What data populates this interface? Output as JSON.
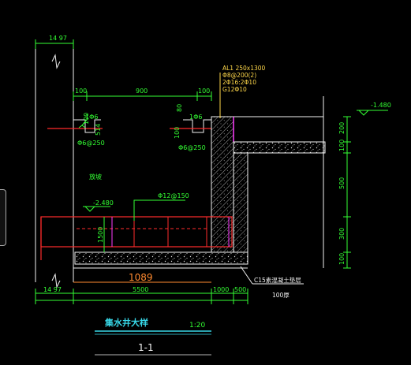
{
  "dims": {
    "top_left_width": "14 97",
    "top_span_left": "100",
    "top_span_mid": "900",
    "top_span_right": "100",
    "right_small_80": "80",
    "bottom_left_width": "14 97",
    "bottom_span_main": "5500",
    "bottom_span_1000": "1000",
    "bottom_span_500": "500",
    "right_200": "200",
    "right_500": "500",
    "right_300": "300",
    "right_100_top": "100",
    "right_100_bottom": "100",
    "height_1500": "1500",
    "level_top": "-1.480",
    "level_bottom": "-2.480",
    "small_left_100": "100",
    "small_left_514": "514",
    "small_right_100": "100",
    "orange_1089": "1089"
  },
  "labels": {
    "rebar_left_top": "1Φ6",
    "rebar_left_bottom": "Φ6@250",
    "rebar_right_top": "1Φ6",
    "rebar_right_bottom": "Φ6@250",
    "rebar_mid": "Φ12@150",
    "beam_title": "AL1 250x1300",
    "beam_l2": "Φ8@200(2)",
    "beam_l3": "2Φ16:2Φ10",
    "beam_l4": "G12Φ10",
    "slope_note": "放坡",
    "concrete_note": "C15素混凝土垫层",
    "concrete_thick": "100厚",
    "title": "集水井大样",
    "scale": "1:20",
    "section": "1-1"
  },
  "colors": {
    "green": "#33ff33",
    "yellow": "#ffd84a",
    "red": "#ff2b2b",
    "white": "#f2f2f2",
    "cyan": "#38d8e8",
    "magenta": "#ff3cff",
    "orange": "#ff8a30"
  }
}
